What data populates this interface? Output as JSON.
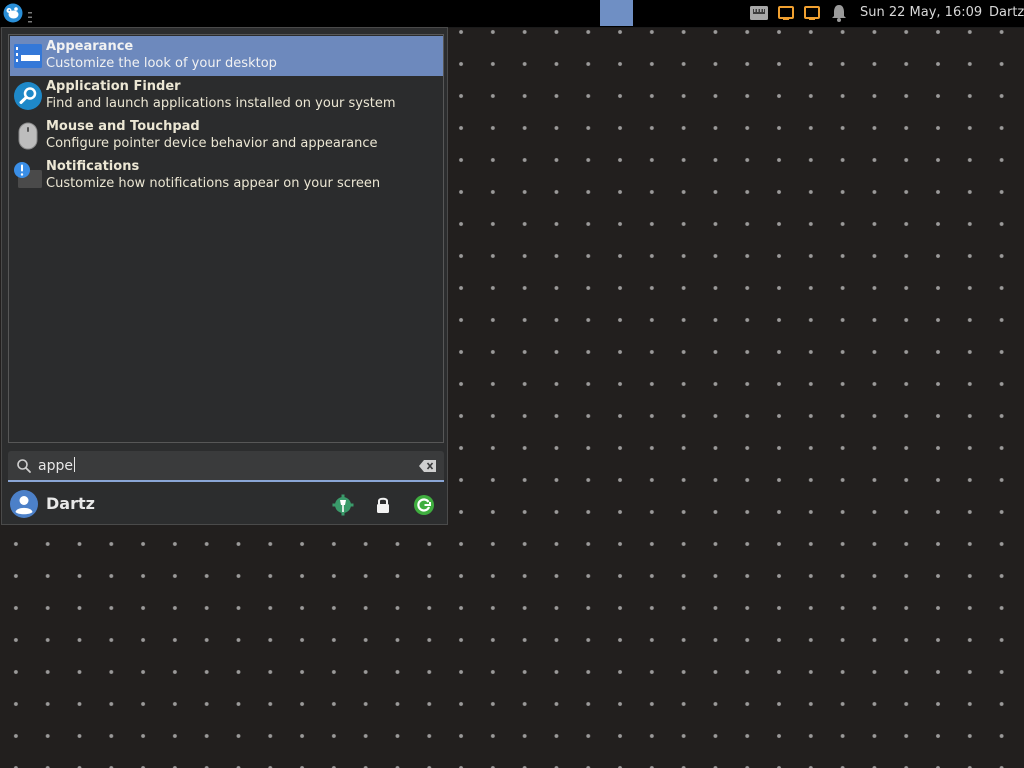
{
  "panel": {
    "menu_button_icon": "xfce-mouse-icon",
    "clock": "Sun 22 May, 16:09",
    "user": "Dartz",
    "tray_icons": [
      "network-wired-icon",
      "window-icon",
      "window-icon",
      "notification-bell-icon"
    ],
    "workspace_color": "#6f8fc4"
  },
  "menu": {
    "results": [
      {
        "title": "Appearance",
        "description": "Customize the look of your desktop",
        "icon": "appearance-icon",
        "selected": true
      },
      {
        "title": "Application Finder",
        "description": "Find and launch applications installed on your system",
        "icon": "app-finder-icon"
      },
      {
        "title": "Mouse and Touchpad",
        "description": "Configure pointer device behavior and appearance",
        "icon": "mouse-icon"
      },
      {
        "title": "Notifications",
        "description": "Customize how notifications appear on your screen",
        "icon": "notifications-icon"
      }
    ],
    "search": {
      "value": "appe",
      "icon": "search-icon",
      "clear_icon": "clear-text-icon"
    },
    "footer": {
      "username": "Dartz",
      "actions": [
        "settings-manager-icon",
        "lock-screen-icon",
        "log-out-icon"
      ]
    }
  },
  "colors": {
    "selection": "#6d89bd",
    "search_underline": "#8aa6d6",
    "desktop": "#221f1e"
  }
}
